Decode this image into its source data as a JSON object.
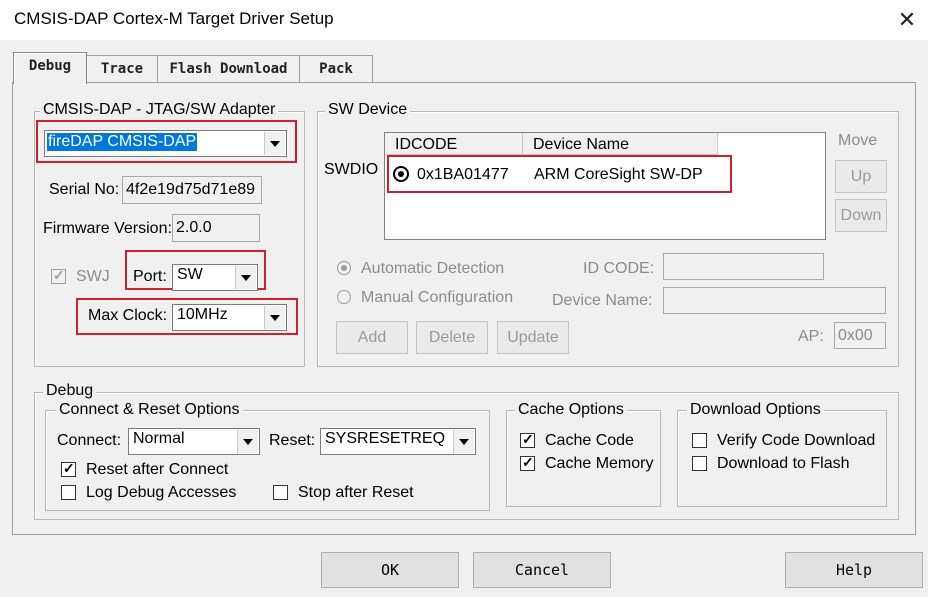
{
  "window": {
    "title": "CMSIS-DAP Cortex-M Target Driver Setup"
  },
  "tabs": [
    {
      "label": "Debug"
    },
    {
      "label": "Trace"
    },
    {
      "label": "Flash Download"
    },
    {
      "label": "Pack"
    }
  ],
  "adapter": {
    "group_label": "CMSIS-DAP - JTAG/SW Adapter",
    "selected": "fireDAP CMSIS-DAP",
    "serial_label": "Serial No:",
    "serial_value": "4f2e19d75d71e89",
    "firmware_label": "Firmware Version:",
    "firmware_value": "2.0.0",
    "swj_label": "SWJ",
    "port_label": "Port:",
    "port_value": "SW",
    "maxclock_label": "Max Clock:",
    "maxclock_value": "10MHz"
  },
  "sw_device": {
    "group_label": "SW Device",
    "swdio_label": "SWDIO",
    "columns": [
      "IDCODE",
      "Device Name"
    ],
    "rows": [
      {
        "idcode": "0x1BA01477",
        "device_name": "ARM CoreSight SW-DP"
      }
    ],
    "move_label": "Move",
    "up_label": "Up",
    "down_label": "Down",
    "auto_detect_label": "Automatic Detection",
    "manual_config_label": "Manual Configuration",
    "id_code_label": "ID CODE:",
    "device_name_label": "Device Name:",
    "add_label": "Add",
    "delete_label": "Delete",
    "update_label": "Update",
    "ap_label": "AP:",
    "ap_value": "0x00"
  },
  "debug": {
    "group_label": "Debug",
    "connect_reset_label": "Connect & Reset Options",
    "connect_label": "Connect:",
    "connect_value": "Normal",
    "reset_label": "Reset:",
    "reset_value": "SYSRESETREQ",
    "reset_after_connect": "Reset after Connect",
    "log_debug_accesses": "Log Debug Accesses",
    "stop_after_reset": "Stop after Reset",
    "cache_options_label": "Cache Options",
    "cache_code": "Cache Code",
    "cache_memory": "Cache Memory",
    "download_options_label": "Download Options",
    "verify_code_download": "Verify Code Download",
    "download_to_flash": "Download to Flash"
  },
  "footer": {
    "ok": "OK",
    "cancel": "Cancel",
    "help": "Help"
  },
  "colors": {
    "highlight": "#0078d7",
    "annotation_red": "#d0202c"
  }
}
